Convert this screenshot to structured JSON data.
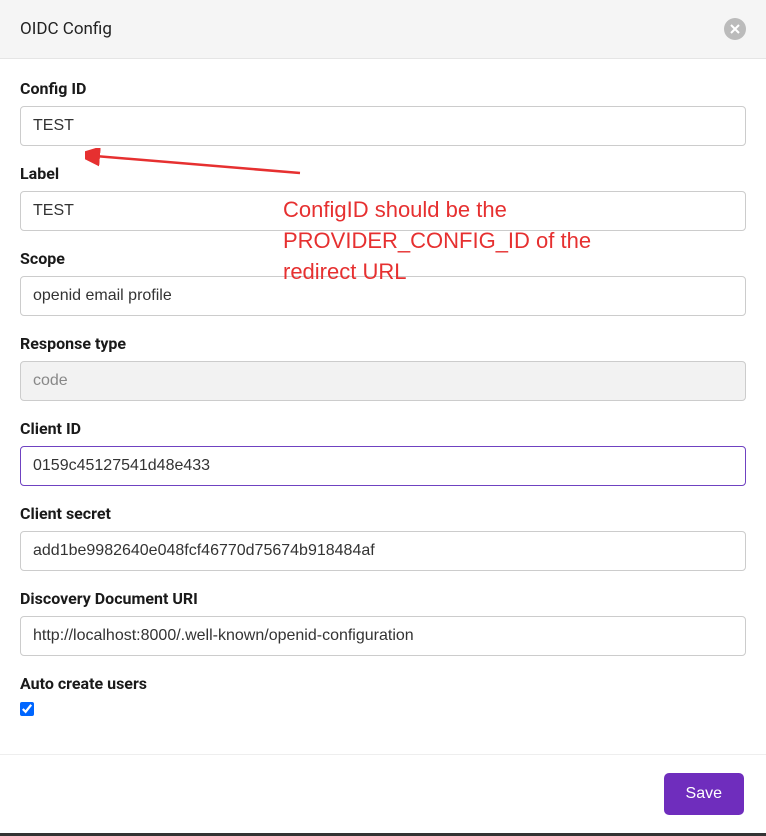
{
  "header": {
    "title": "OIDC Config"
  },
  "form": {
    "configId": {
      "label": "Config ID",
      "value": "TEST"
    },
    "label": {
      "label": "Label",
      "value": "TEST"
    },
    "scope": {
      "label": "Scope",
      "value": "openid email profile"
    },
    "responseType": {
      "label": "Response type",
      "value": "code"
    },
    "clientId": {
      "label": "Client ID",
      "value": "0159c45127541d48e433"
    },
    "clientSecret": {
      "label": "Client secret",
      "value": "add1be9982640e048fcf46770d75674b918484af"
    },
    "discoveryUri": {
      "label": "Discovery Document URI",
      "value": "http://localhost:8000/.well-known/openid-configuration"
    },
    "autoCreate": {
      "label": "Auto create users"
    }
  },
  "footer": {
    "save_label": "Save"
  },
  "annotation": {
    "text": "ConfigID should be the PROVIDER_CONFIG_ID of the redirect URL"
  }
}
